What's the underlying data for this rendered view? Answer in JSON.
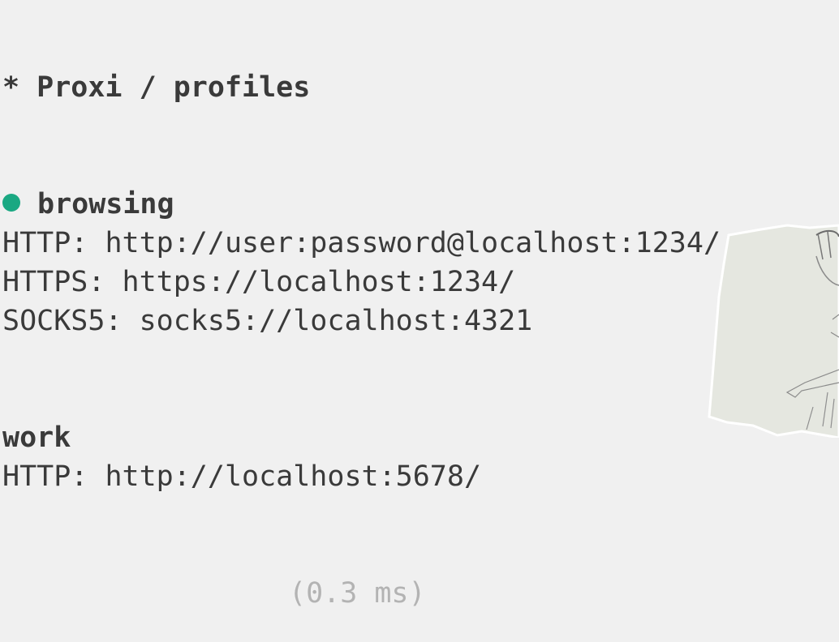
{
  "header": {
    "title": "* Proxi / profiles"
  },
  "profiles": [
    {
      "name": "browsing",
      "active": true,
      "entries": [
        {
          "label": "HTTP:",
          "value": "http://user:password@localhost:1234/"
        },
        {
          "label": "HTTPS:",
          "value": "https://localhost:1234/"
        },
        {
          "label": "SOCKS5:",
          "value": "socks5://localhost:4321"
        }
      ]
    },
    {
      "name": "work",
      "active": false,
      "entries": [
        {
          "label": "HTTP:",
          "value": "http://localhost:5678/"
        }
      ]
    }
  ],
  "footer": {
    "timing": "(0.3 ms)"
  },
  "colors": {
    "background": "#f0f0f0",
    "text": "#3a3a3a",
    "active_dot": "#1aa882",
    "muted": "#b3b3b3"
  }
}
